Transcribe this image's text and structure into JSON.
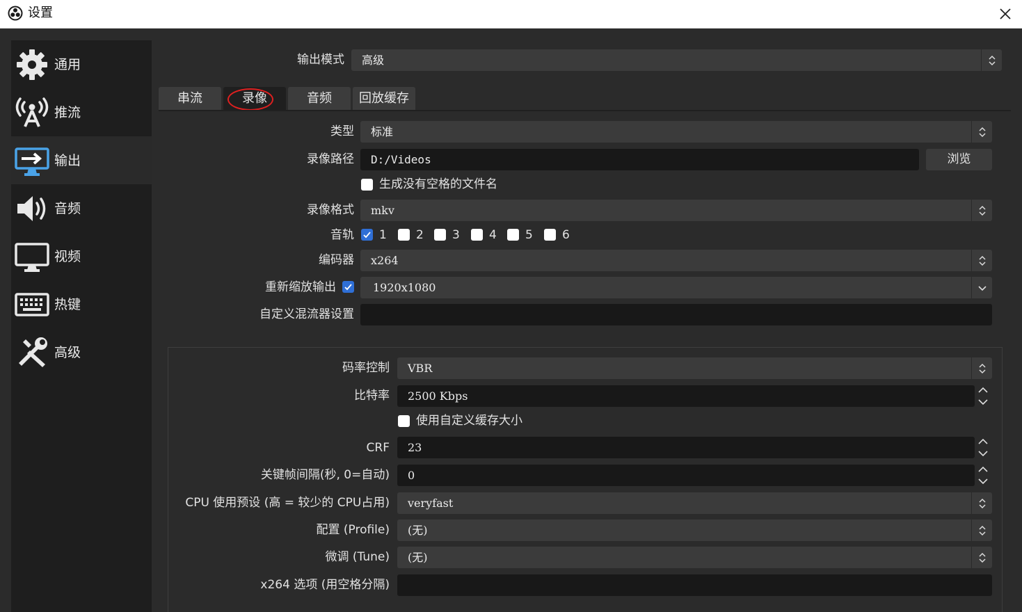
{
  "window": {
    "title": "设置",
    "app_icon": "obs-logo-icon",
    "close_icon": "close-icon"
  },
  "sidebar": {
    "items": [
      {
        "label": "通用",
        "icon": "gear-icon",
        "active": false
      },
      {
        "label": "推流",
        "icon": "broadcast-antenna-icon",
        "active": false
      },
      {
        "label": "输出",
        "icon": "monitor-output-icon",
        "active": true
      },
      {
        "label": "音频",
        "icon": "speaker-icon",
        "active": false
      },
      {
        "label": "视频",
        "icon": "monitor-icon",
        "active": false
      },
      {
        "label": "热键",
        "icon": "keyboard-icon",
        "active": false
      },
      {
        "label": "高级",
        "icon": "tools-icon",
        "active": false
      }
    ]
  },
  "output_mode": {
    "label": "输出模式",
    "value": "高级"
  },
  "tabs": [
    {
      "label": "串流",
      "active": false
    },
    {
      "label": "录像",
      "active": true
    },
    {
      "label": "音频",
      "active": false
    },
    {
      "label": "回放缓存",
      "active": false
    }
  ],
  "recording": {
    "type": {
      "label": "类型",
      "value": "标准"
    },
    "path": {
      "label": "录像路径",
      "value": "D:/Videos",
      "browse_label": "浏览"
    },
    "no_space_filename": {
      "label": "生成没有空格的文件名",
      "checked": false
    },
    "format": {
      "label": "录像格式",
      "value": "mkv"
    },
    "audio_track": {
      "label": "音轨",
      "tracks": [
        {
          "num": "1",
          "checked": true
        },
        {
          "num": "2",
          "checked": false
        },
        {
          "num": "3",
          "checked": false
        },
        {
          "num": "4",
          "checked": false
        },
        {
          "num": "5",
          "checked": false
        },
        {
          "num": "6",
          "checked": false
        }
      ]
    },
    "encoder": {
      "label": "编码器",
      "value": "x264"
    },
    "rescale": {
      "label": "重新缩放输出",
      "checked": true,
      "value": "1920x1080"
    },
    "muxer": {
      "label": "自定义混流器设置",
      "value": ""
    }
  },
  "encoder_settings": {
    "rate_control": {
      "label": "码率控制",
      "value": "VBR"
    },
    "bitrate": {
      "label": "比特率",
      "value": "2500 Kbps"
    },
    "custom_buffer": {
      "label": "使用自定义缓存大小",
      "checked": false
    },
    "crf": {
      "label": "CRF",
      "value": "23"
    },
    "keyframe": {
      "label": "关键帧间隔(秒, 0=自动)",
      "value": "0"
    },
    "cpu_preset": {
      "label": "CPU 使用预设 (高 = 较少的 CPU占用)",
      "value": "veryfast"
    },
    "profile": {
      "label": "配置 (Profile)",
      "value": "(无)"
    },
    "tune": {
      "label": "微调 (Tune)",
      "value": "(无)"
    },
    "x264_opts": {
      "label": "x264 选项 (用空格分隔)",
      "value": ""
    }
  },
  "colors": {
    "accent": "#2f6fd6",
    "annotation": "#e02020",
    "background": "#2b2b2b",
    "sidebar": "#1e1e1e"
  }
}
